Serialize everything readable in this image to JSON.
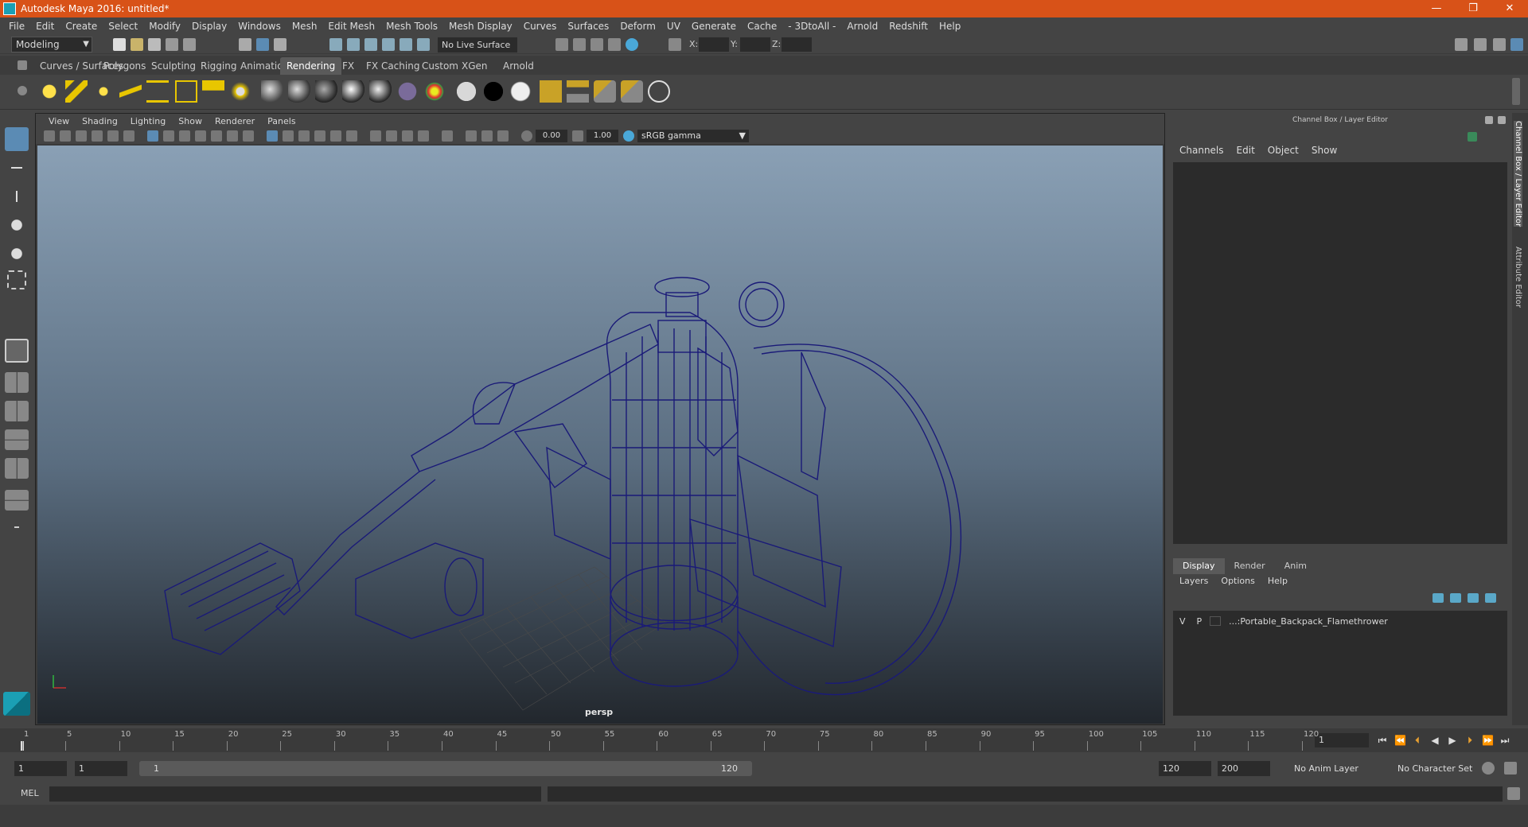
{
  "window": {
    "title": "Autodesk Maya 2016: untitled*",
    "min": "—",
    "max": "❐",
    "close": "✕"
  },
  "menubar": [
    "File",
    "Edit",
    "Create",
    "Select",
    "Modify",
    "Display",
    "Windows",
    "Mesh",
    "Edit Mesh",
    "Mesh Tools",
    "Mesh Display",
    "Curves",
    "Surfaces",
    "Deform",
    "UV",
    "Generate",
    "Cache",
    "- 3DtoAll -",
    "Arnold",
    "Redshift",
    "Help"
  ],
  "statusline": {
    "mode": "Modeling",
    "live_surface": "No Live Surface",
    "x_label": "X:",
    "y_label": "Y:",
    "z_label": "Z:"
  },
  "shelf_tabs": [
    "Curves / Surfaces",
    "Polygons",
    "Sculpting",
    "Rigging",
    "Animation",
    "Rendering",
    "FX",
    "FX Caching",
    "Custom",
    "XGen",
    "Arnold"
  ],
  "active_shelf": "Rendering",
  "viewport": {
    "menu": [
      "View",
      "Shading",
      "Lighting",
      "Show",
      "Renderer",
      "Panels"
    ],
    "exposure": "0.00",
    "gamma": "1.00",
    "color_space": "sRGB gamma",
    "camera_label": "persp"
  },
  "channel_box": {
    "header": "Channel Box / Layer Editor",
    "menu": [
      "Channels",
      "Edit",
      "Object",
      "Show"
    ]
  },
  "layer_editor": {
    "tabs": [
      "Display",
      "Render",
      "Anim"
    ],
    "active_tab": "Display",
    "menu": [
      "Layers",
      "Options",
      "Help"
    ],
    "layers": [
      {
        "v": "V",
        "p": "P",
        "name": "...:Portable_Backpack_Flamethrower"
      }
    ]
  },
  "side_tabs": [
    "Channel Box / Layer Editor",
    "Attribute Editor"
  ],
  "timeline": {
    "ticks": [
      "1",
      "5",
      "10",
      "15",
      "20",
      "25",
      "30",
      "35",
      "40",
      "45",
      "50",
      "55",
      "60",
      "65",
      "70",
      "75",
      "80",
      "85",
      "90",
      "95",
      "100",
      "105",
      "110",
      "115",
      "120"
    ],
    "current_frame": "1"
  },
  "range": {
    "start": "1",
    "playback_start": "1",
    "slider_start": "1",
    "slider_end": "120",
    "playback_end": "120",
    "end": "200",
    "anim_layer": "No Anim Layer",
    "character_set": "No Character Set"
  },
  "cmdline": {
    "label": "MEL"
  },
  "colors": {
    "title_bar": "#d85218",
    "wireframe": "#1a1a78",
    "active_tool": "#5b8bb4"
  }
}
